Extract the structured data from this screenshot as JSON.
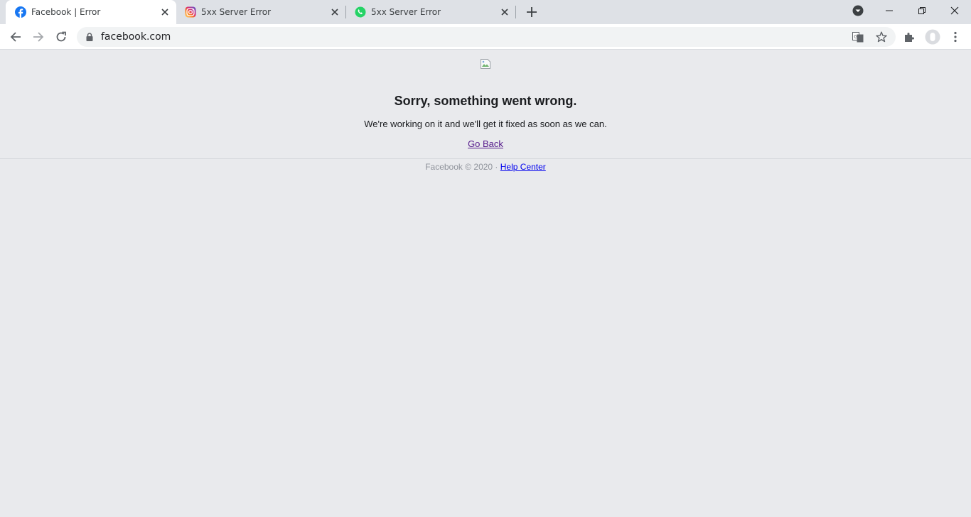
{
  "browser": {
    "tabs": [
      {
        "title": "Facebook | Error",
        "favicon": "facebook-icon",
        "active": true
      },
      {
        "title": "5xx Server Error",
        "favicon": "instagram-icon",
        "active": false
      },
      {
        "title": "5xx Server Error",
        "favicon": "whatsapp-icon",
        "active": false
      }
    ],
    "address": "facebook.com"
  },
  "page": {
    "heading": "Sorry, something went wrong.",
    "message": "We're working on it and we'll get it fixed as soon as we can.",
    "go_back": "Go Back",
    "footer_text": "Facebook © 2020 · ",
    "help_center": "Help Center"
  },
  "colors": {
    "page_bg": "#e9eaed",
    "visited_link": "#551a8b",
    "link": "#0000ee"
  }
}
